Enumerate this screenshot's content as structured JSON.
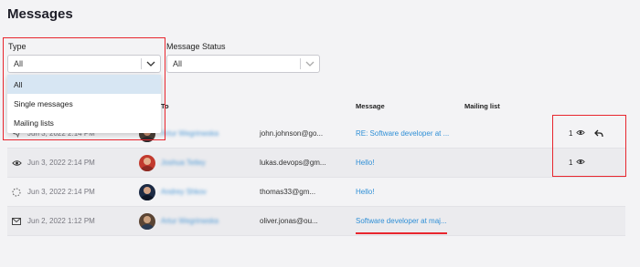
{
  "page": {
    "title": "Messages"
  },
  "filters": {
    "type": {
      "label": "Type",
      "value": "All"
    },
    "status": {
      "label": "Message Status",
      "value": "All"
    }
  },
  "type_dropdown": {
    "options": [
      "All",
      "Single messages",
      "Mailing lists"
    ],
    "selected": "All"
  },
  "table": {
    "columns": {
      "to": "To",
      "message": "Message",
      "mailing_list": "Mailing list"
    },
    "rows": [
      {
        "status_icon": "sent-icon",
        "date": "Jun 3, 2022 2:14 PM",
        "name": "Artur Wegrinwska",
        "email": "john.johnson@go...",
        "message": "RE: Software developer at ...",
        "count": "1",
        "has_reply": true,
        "avatar_colors": [
          "#4a3e36",
          "#c98f72"
        ]
      },
      {
        "status_icon": "eye-icon",
        "date": "Jun 3, 2022 2:14 PM",
        "name": "Joshua Tetley",
        "email": "lukas.devops@gm...",
        "message": "Hello!",
        "count": "1",
        "has_reply": false,
        "avatar_colors": [
          "#c23a2e",
          "#e4b08e"
        ]
      },
      {
        "status_icon": "pending-icon",
        "date": "Jun 3, 2022 2:14 PM",
        "name": "Andrey Shkov",
        "email": "thomas33@gm...",
        "message": "Hello!",
        "count": "",
        "has_reply": false,
        "avatar_colors": [
          "#1c2a44",
          "#d3a285"
        ]
      },
      {
        "status_icon": "mail-icon",
        "date": "Jun 2, 2022 1:12 PM",
        "name": "Artur Wegrinwska",
        "email": "oliver.jonas@ou...",
        "message": "Software developer at maj...",
        "count": "",
        "has_reply": false,
        "avatar_colors": [
          "#5a4434",
          "#caa07e"
        ]
      }
    ]
  },
  "colors": {
    "link": "#2f8fd6",
    "highlight": "#e8262e",
    "selected_option": "#d7e6f3"
  }
}
